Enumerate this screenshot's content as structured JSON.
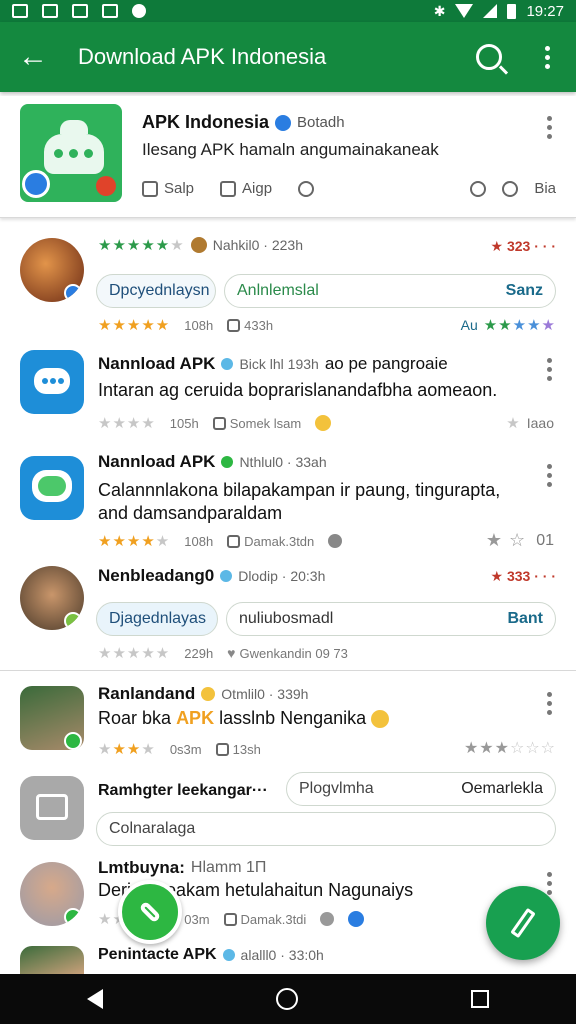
{
  "status_bar": {
    "time": "19:27"
  },
  "appbar": {
    "title": "Download APK Indonesia",
    "back_icon": "arrow-back-icon",
    "search_icon": "search-icon",
    "menu_icon": "more-vert-icon"
  },
  "featured": {
    "title": "APK Indonesia",
    "subtitle": "Botadh",
    "description": "Ilesang APK hamaln angumainakaneak",
    "action1": "Salp",
    "action2": "Aigp",
    "right_label": "Bia"
  },
  "items": [
    {
      "meta": "Nahkil0 · 223h",
      "rank": "323 · · ·",
      "chip": "Dpcyednlaysn",
      "input_value": "Anlnlemslal",
      "input_end": "Sanz",
      "foot1": "108h",
      "foot2": "433h",
      "foot_right": "Au"
    },
    {
      "title": "Nannload APK",
      "meta": "Bick lhl 193h",
      "meta2": "ao pe pangroaie",
      "desc": "Intaran ag ceruida boprarislanandafbha aomeaon.",
      "foot1": "105h",
      "foot2": "Somek lsam",
      "foot_right": "Iaao"
    },
    {
      "title": "Nannload APK",
      "meta": "Nthlul0 · 33ah",
      "desc1": "Calannnlakona bilapakampan ir paung, tingurapta,",
      "desc2": "and damsandparaldam",
      "foot1": "108h",
      "foot2": "Damak.3tdn",
      "foot_right": "01"
    },
    {
      "title": "Nenbleadang0",
      "meta": "Dlodip · 20:3h",
      "rank": "333 · · ·",
      "chip": "Djagednlayas",
      "input_value": "nuliubosmadl",
      "input_end": "Bant",
      "foot1": "229h",
      "foot2": "Gwenkandin 09 73"
    },
    {
      "title": "Ranlandand",
      "meta": "Otmlil0 · 339h",
      "desc_pre": "Roar bka",
      "desc_hl": "APK",
      "desc_post": "lasslnb Nenganika",
      "foot1": "0s3m",
      "foot2": "13sh"
    },
    {
      "title": "Ramhgter leekangar···",
      "input1": "Plogvlmha",
      "input1_end": "Oemarlekla",
      "input2": "Colnaralaga"
    },
    {
      "title": "Lmtbuyna:",
      "meta": "Hlamm 1П",
      "desc": "Derjonrveakam hetulahaitun Nagunaiys",
      "foot1": "03m",
      "foot2": "Damak.3tdi"
    },
    {
      "title": "Penintacte APK",
      "meta": "alalll0 · 33:0h"
    }
  ],
  "colors": {
    "primary": "#14893f",
    "status": "#0e7a3a",
    "accent_star": "#f0a020",
    "rank": "#c0392b",
    "fab": "#18a050"
  }
}
